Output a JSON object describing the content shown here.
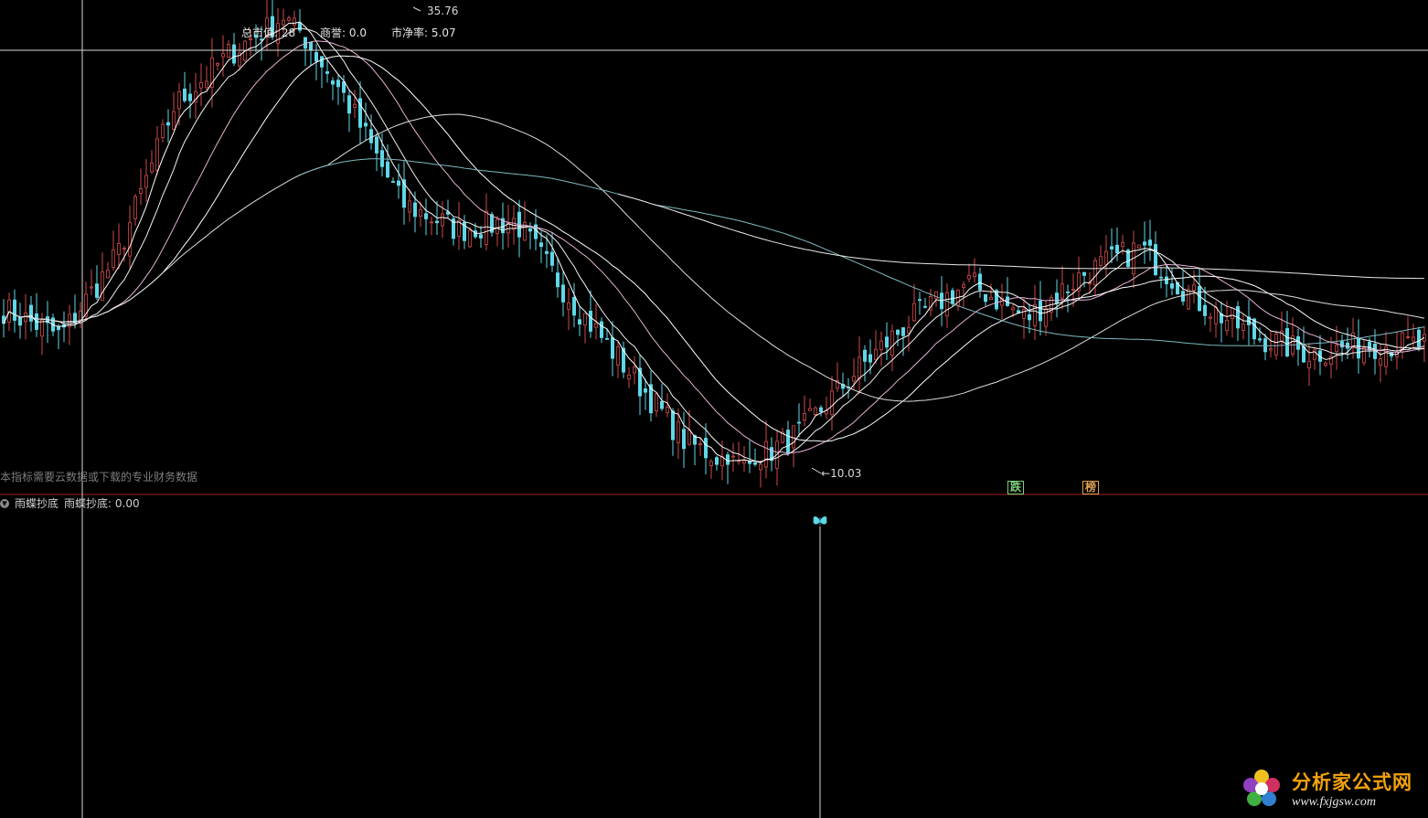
{
  "info_bar": {
    "market_cap_label": "总市值:",
    "market_cap_value": "28",
    "goodwill_label": "商誉:",
    "goodwill_value": "0.0",
    "pb_label": "市净率:",
    "pb_value": "5.07"
  },
  "price_marks": {
    "high": "35.76",
    "low": "10.03"
  },
  "notice": "本指标需要云数据或下载的专业财务数据",
  "signals": {
    "fall": "跌",
    "rank": "榜"
  },
  "indicator_panel": {
    "name": "雨蝶抄底",
    "value_label": "雨蝶抄底:",
    "value": "0.00",
    "marker_icon": "butterfly-icon"
  },
  "watermark": {
    "name": "分析家公式网",
    "url": "www.fxjgsw.com",
    "icon": "flower-logo-icon"
  },
  "colors": {
    "up": "#d04a4a",
    "down": "#5fd7e6",
    "ma_short": "#ffffff",
    "ma_mid": "#e6b3d6",
    "ma_long": "#7fb9bf",
    "panel_divider": "#a02020",
    "crosshair": "#d8d8d8",
    "logo_text": "#f2a20c"
  },
  "chart_data": {
    "type": "candlestick",
    "price_high_marked": 35.76,
    "price_low_marked": 10.03,
    "trend_waypoints": [
      19,
      17.5,
      22,
      30.5,
      33.5,
      35.76,
      31,
      25,
      23.5,
      24,
      19.5,
      15.5,
      11.5,
      10.03,
      12,
      15.5,
      18.5,
      20.5,
      18.5,
      21,
      22.5,
      19.5,
      17.5,
      16.5,
      17,
      17
    ]
  }
}
